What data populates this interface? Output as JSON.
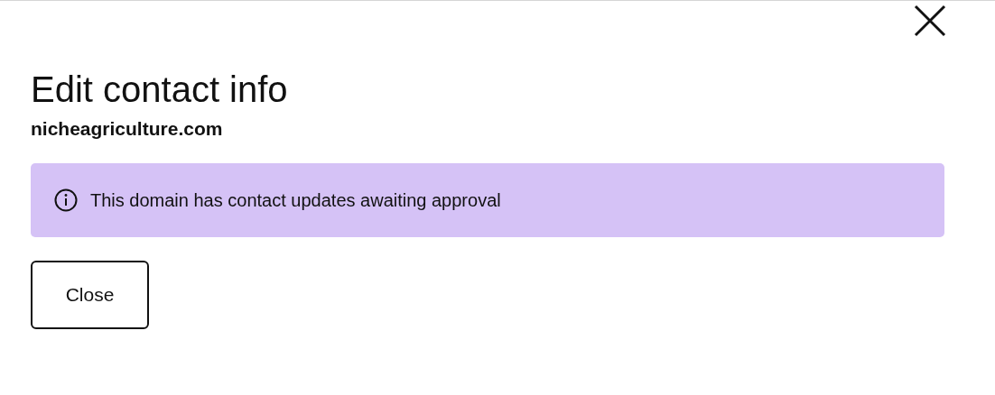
{
  "dialog": {
    "title": "Edit contact info",
    "subtitle": "nicheagriculture.com",
    "notice": {
      "text": "This domain has contact updates awaiting approval"
    },
    "buttons": [
      "Close"
    ]
  }
}
